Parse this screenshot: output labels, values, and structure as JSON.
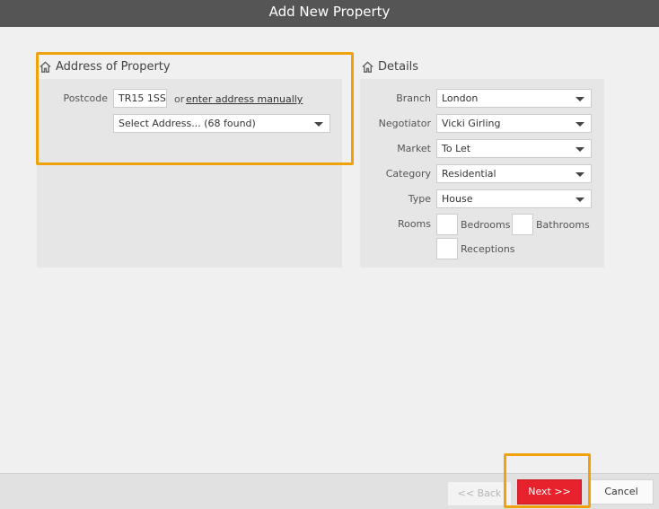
{
  "window": {
    "title": "Add New Property"
  },
  "address_panel": {
    "title": "Address of Property",
    "postcode_label": "Postcode",
    "postcode_value": "TR15 1SS",
    "or_text": "or",
    "manual_link": "enter address manually",
    "address_select": "Select Address... (68 found)"
  },
  "details_panel": {
    "title": "Details",
    "fields": [
      {
        "label": "Branch",
        "value": "London"
      },
      {
        "label": "Negotiator",
        "value": "Vicki Girling"
      },
      {
        "label": "Market",
        "value": "To Let"
      },
      {
        "label": "Category",
        "value": "Residential"
      },
      {
        "label": "Type",
        "value": "House"
      }
    ],
    "rooms_label": "Rooms",
    "rooms": [
      "Bedrooms",
      "Bathrooms",
      "Receptions"
    ]
  },
  "footer": {
    "back_label": "<< Back",
    "next_label": "Next >>",
    "cancel_label": "Cancel"
  },
  "colors": {
    "title_bar": "#555555",
    "highlight": "#f0a20c",
    "next_button": "#e8222c"
  }
}
